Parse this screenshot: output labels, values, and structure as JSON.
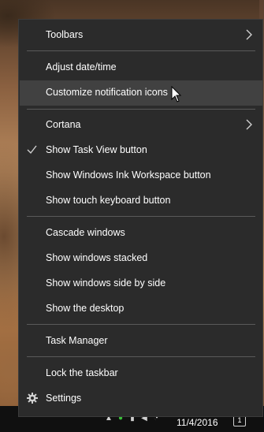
{
  "menu": {
    "toolbars": "Toolbars",
    "adjust_datetime": "Adjust date/time",
    "customize_notification_icons": "Customize notification icons",
    "cortana": "Cortana",
    "show_task_view": "Show Task View button",
    "show_ink_workspace": "Show Windows Ink Workspace button",
    "show_touch_keyboard": "Show touch keyboard button",
    "cascade_windows": "Cascade windows",
    "show_windows_stacked": "Show windows stacked",
    "show_windows_side_by_side": "Show windows side by side",
    "show_desktop": "Show the desktop",
    "task_manager": "Task Manager",
    "lock_taskbar": "Lock the taskbar",
    "settings": "Settings",
    "task_view_checked": true,
    "hovered_item": "Customize notification icons"
  },
  "taskbar": {
    "date": "11/4/2016",
    "notification_count": "1"
  },
  "colors": {
    "menu_bg": "#2b2b2b",
    "hover_bg": "#414141",
    "separator": "#5a5a5a",
    "text": "#ffffff"
  },
  "icons": [
    "chevron-right-icon",
    "checkmark-icon",
    "gear-icon",
    "mouse-cursor-icon",
    "notification-icon"
  ]
}
